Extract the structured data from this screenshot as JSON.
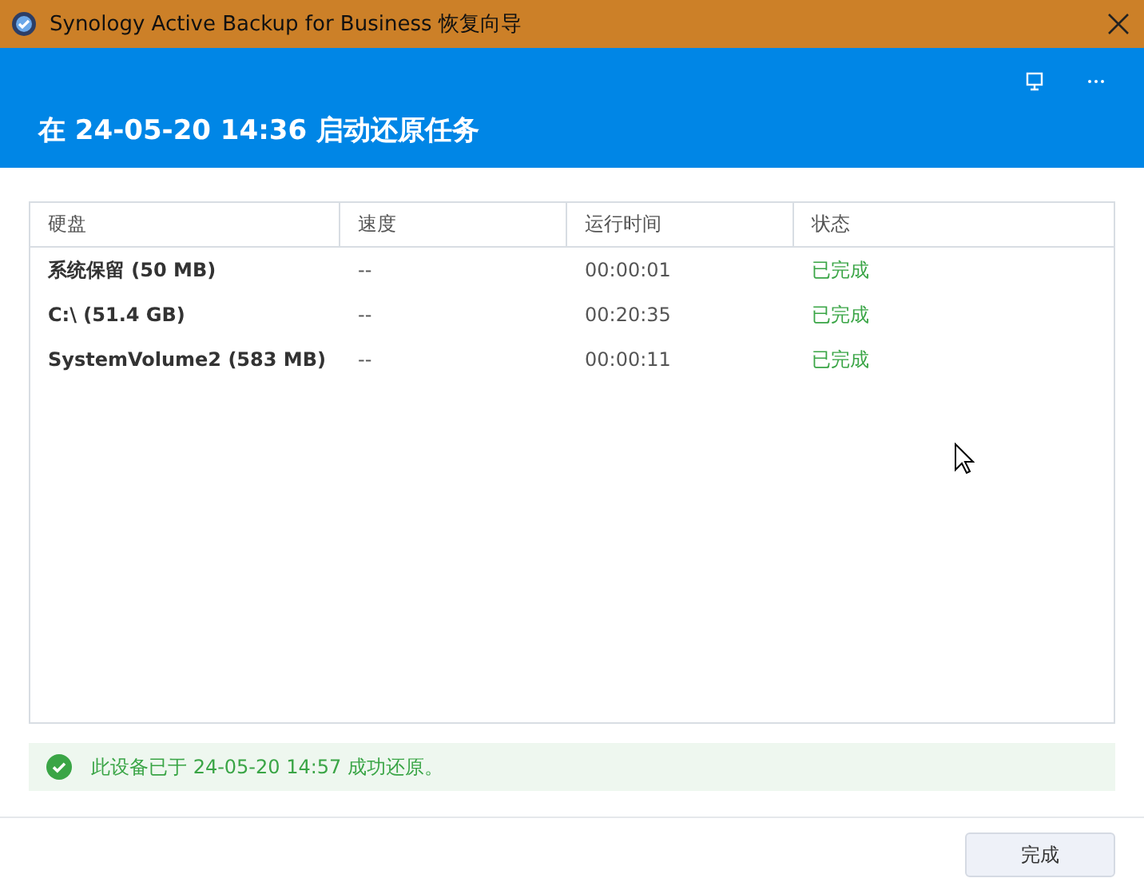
{
  "window": {
    "title": "Synology Active Backup for Business 恢复向导"
  },
  "header": {
    "title": "在 24-05-20 14:36 启动还原任务"
  },
  "table": {
    "columns": [
      "硬盘",
      "速度",
      "运行时间",
      "状态"
    ],
    "rows": [
      {
        "disk": "系统保留 (50 MB)",
        "speed": "--",
        "runtime": "00:00:01",
        "status": "已完成"
      },
      {
        "disk": "C:\\ (51.4 GB)",
        "speed": "--",
        "runtime": "00:20:35",
        "status": "已完成"
      },
      {
        "disk": "SystemVolume2 (583 MB)",
        "speed": "--",
        "runtime": "00:00:11",
        "status": "已完成"
      }
    ]
  },
  "message": {
    "text": "此设备已于 24-05-20 14:57 成功还原。"
  },
  "buttons": [
    "完成"
  ]
}
